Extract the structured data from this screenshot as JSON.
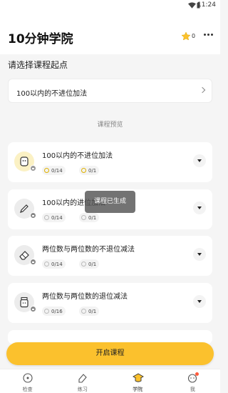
{
  "status_bar": {
    "time": "11:24"
  },
  "header": {
    "title": "10分钟学院",
    "stars": "0"
  },
  "section": {
    "title": "请选择课程起点"
  },
  "start_point": {
    "selected": "100以内的不进位加法"
  },
  "preview": {
    "title": "课程预览"
  },
  "courses": [
    {
      "name": "100以内的不进位加法",
      "stat1": "0/14",
      "stat2": "0/1",
      "icon": "bread-icon",
      "locked": false
    },
    {
      "name": "100以内的进位加法",
      "stat1": "0/14",
      "stat2": "0/1",
      "icon": "pencil-icon",
      "locked": true
    },
    {
      "name": "两位数与两位数的不退位减法",
      "stat1": "0/14",
      "stat2": "0/1",
      "icon": "eraser-icon",
      "locked": true
    },
    {
      "name": "两位数与两位数的退位减法",
      "stat1": "0/16",
      "stat2": "0/1",
      "icon": "jar-icon",
      "locked": true
    }
  ],
  "toast": "课程已生成",
  "cta": {
    "label": "开启课程"
  },
  "tabs": [
    {
      "label": "检查",
      "icon": "check-icon"
    },
    {
      "label": "练习",
      "icon": "practice-icon"
    },
    {
      "label": "学院",
      "icon": "academy-icon",
      "active": true
    },
    {
      "label": "我",
      "icon": "profile-icon"
    }
  ],
  "colors": {
    "accent": "#fbc12d",
    "background": "#f5f5f5",
    "badge": "#ff5a3c"
  }
}
